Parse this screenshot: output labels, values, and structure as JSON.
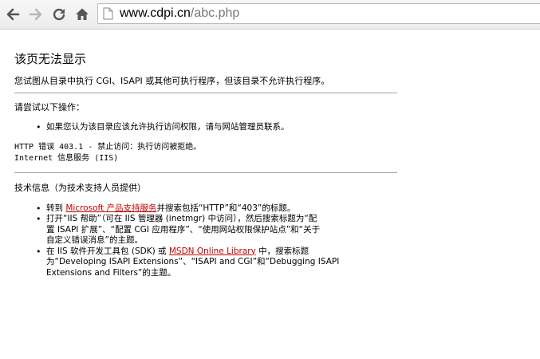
{
  "browser": {
    "url_host": "www.cdpi.cn",
    "url_path": "/abc.php",
    "icons": [
      "back-icon",
      "forward-icon",
      "reload-icon",
      "home-icon",
      "page-icon"
    ]
  },
  "page": {
    "title": "该页无法显示",
    "intro": "您试图从目录中执行 CGI、ISAPI 或其他可执行程序，但该目录不允许执行程序。",
    "try_heading": "请尝试以下操作：",
    "try_items": [
      "如果您认为该目录应该允许执行访问权限，请与网站管理员联系。"
    ],
    "error_line1": "HTTP 错误 403.1 - 禁止访问：执行访问被拒绝。",
    "error_line2": "Internet 信息服务 (IIS)",
    "tech_heading": "技术信息（为技术支持人员提供）",
    "tech_items": [
      {
        "prefix": "转到 ",
        "link": "Microsoft 产品支持服务",
        "suffix": "并搜索包括“HTTP”和“403”的标题。"
      },
      {
        "line1": "打开“IIS 帮助”（可在 IIS 管理器 (inetmgr) 中访问），然后搜索标题为“配",
        "line2": "置 ISAPI 扩展”、“配置 CGI 应用程序”、“使用网站权限保护站点”和“关于",
        "line3": "自定义错误消息”的主题。"
      },
      {
        "prefix": "在 IIS 软件开发工具包 (SDK) 或 ",
        "link": "MSDN Online Library",
        "suffix": " 中，搜索标题",
        "line2": "为“Developing ISAPI Extensions”、“ISAPI and CGI”和“Debugging ISAPI",
        "line3": "Extensions and Filters”的主题。"
      }
    ]
  },
  "colors": {
    "link": "#c00000",
    "rule": "#a0a0a0",
    "url_path": "#777777"
  }
}
